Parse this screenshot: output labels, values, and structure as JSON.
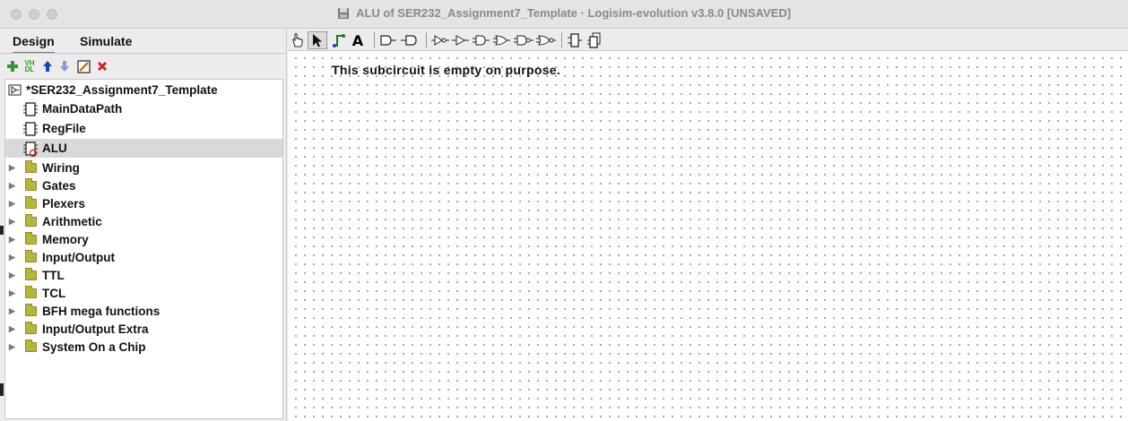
{
  "window": {
    "title": "ALU of SER232_Assignment7_Template · Logisim-evolution v3.8.0 [UNSAVED]"
  },
  "tabs": [
    {
      "label": "Design",
      "active": true
    },
    {
      "label": "Simulate",
      "active": false
    }
  ],
  "project_toolbar": {
    "icons": [
      "add-circuit-icon",
      "add-vhdl-icon",
      "move-up-icon",
      "move-down-icon",
      "edit-appearance-icon",
      "delete-icon"
    ],
    "vhdl_label": "VH\nDL",
    "colors": {
      "add": "#2e9a2e",
      "up": "#1a3fd0",
      "down": "#8a9ad8",
      "delete": "#d42020"
    }
  },
  "tree": {
    "project": "*SER232_Assignment7_Template",
    "circuits": [
      {
        "label": "MainDataPath",
        "selected": false
      },
      {
        "label": "RegFile",
        "selected": false
      },
      {
        "label": "ALU",
        "selected": true
      }
    ],
    "libraries": [
      {
        "label": "Wiring"
      },
      {
        "label": "Gates"
      },
      {
        "label": "Plexers"
      },
      {
        "label": "Arithmetic"
      },
      {
        "label": "Memory"
      },
      {
        "label": "Input/Output"
      },
      {
        "label": "TTL"
      },
      {
        "label": "TCL"
      },
      {
        "label": "BFH mega functions"
      },
      {
        "label": "Input/Output Extra"
      },
      {
        "label": "System On a Chip"
      }
    ]
  },
  "main_toolbar": {
    "tools": [
      "poke-tool-icon",
      "select-tool-icon",
      "wiring-tool-icon",
      "text-tool-icon",
      "input-pin-icon",
      "output-pin-icon",
      "not-gate-icon",
      "buffer-icon",
      "and-gate-icon",
      "or-gate-icon",
      "nand-gate-icon",
      "nor-gate-icon",
      "subcircuit-icon",
      "appearance-icon"
    ],
    "selected": "select-tool-icon",
    "text_tool_label": "A"
  },
  "canvas": {
    "message": "This subcircuit is empty on purpose."
  }
}
